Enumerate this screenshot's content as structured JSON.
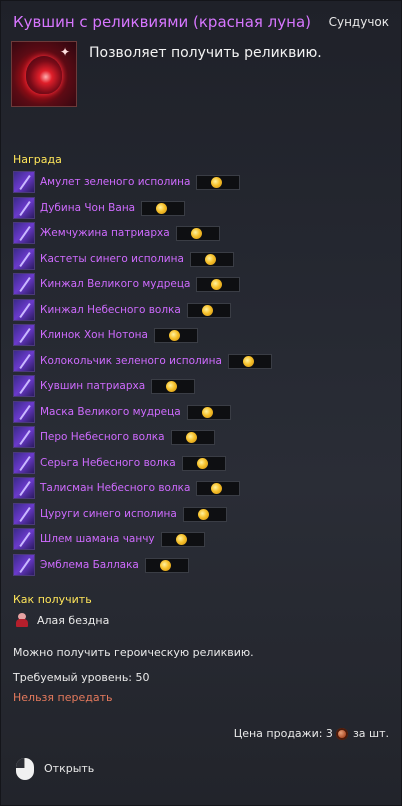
{
  "header": {
    "title": "Кувшин с реликвиями (красная луна)",
    "category": "Сундучок",
    "description": "Позволяет получить реликвию.",
    "icon": "red-jar-icon"
  },
  "reward": {
    "label": "Награда",
    "items": [
      {
        "name": "Амулет зеленого исполина"
      },
      {
        "name": "Дубина Чон Вана"
      },
      {
        "name": "Жемчужина патриарха"
      },
      {
        "name": "Кастеты синего исполина"
      },
      {
        "name": "Кинжал Великого мудреца"
      },
      {
        "name": "Кинжал Небесного волка"
      },
      {
        "name": "Клинок Хон Нотона"
      },
      {
        "name": "Колокольчик зеленого исполина"
      },
      {
        "name": "Кувшин патриарха"
      },
      {
        "name": "Маска Великого мудреца"
      },
      {
        "name": "Перо Небесного волка"
      },
      {
        "name": "Серьга Небесного волка"
      },
      {
        "name": "Талисман Небесного волка"
      },
      {
        "name": "Цуруги синего исполина"
      },
      {
        "name": "Шлем шамана чанчу"
      },
      {
        "name": "Эмблема Баллака"
      }
    ]
  },
  "obtain": {
    "label": "Как получить",
    "source": "Алая бездна"
  },
  "info": {
    "note": "Можно получить героическую реликвию.",
    "required_level": "Требуемый уровень: 50",
    "untradable": "Нельзя передать"
  },
  "price": {
    "label": "Цена продажи: 3",
    "unit": "за шт."
  },
  "action": {
    "open": "Открыть"
  },
  "colors": {
    "title": "#d776ff",
    "section": "#ffe65a",
    "reward_name": "#cf6bff",
    "untradable": "#e57a5d"
  }
}
